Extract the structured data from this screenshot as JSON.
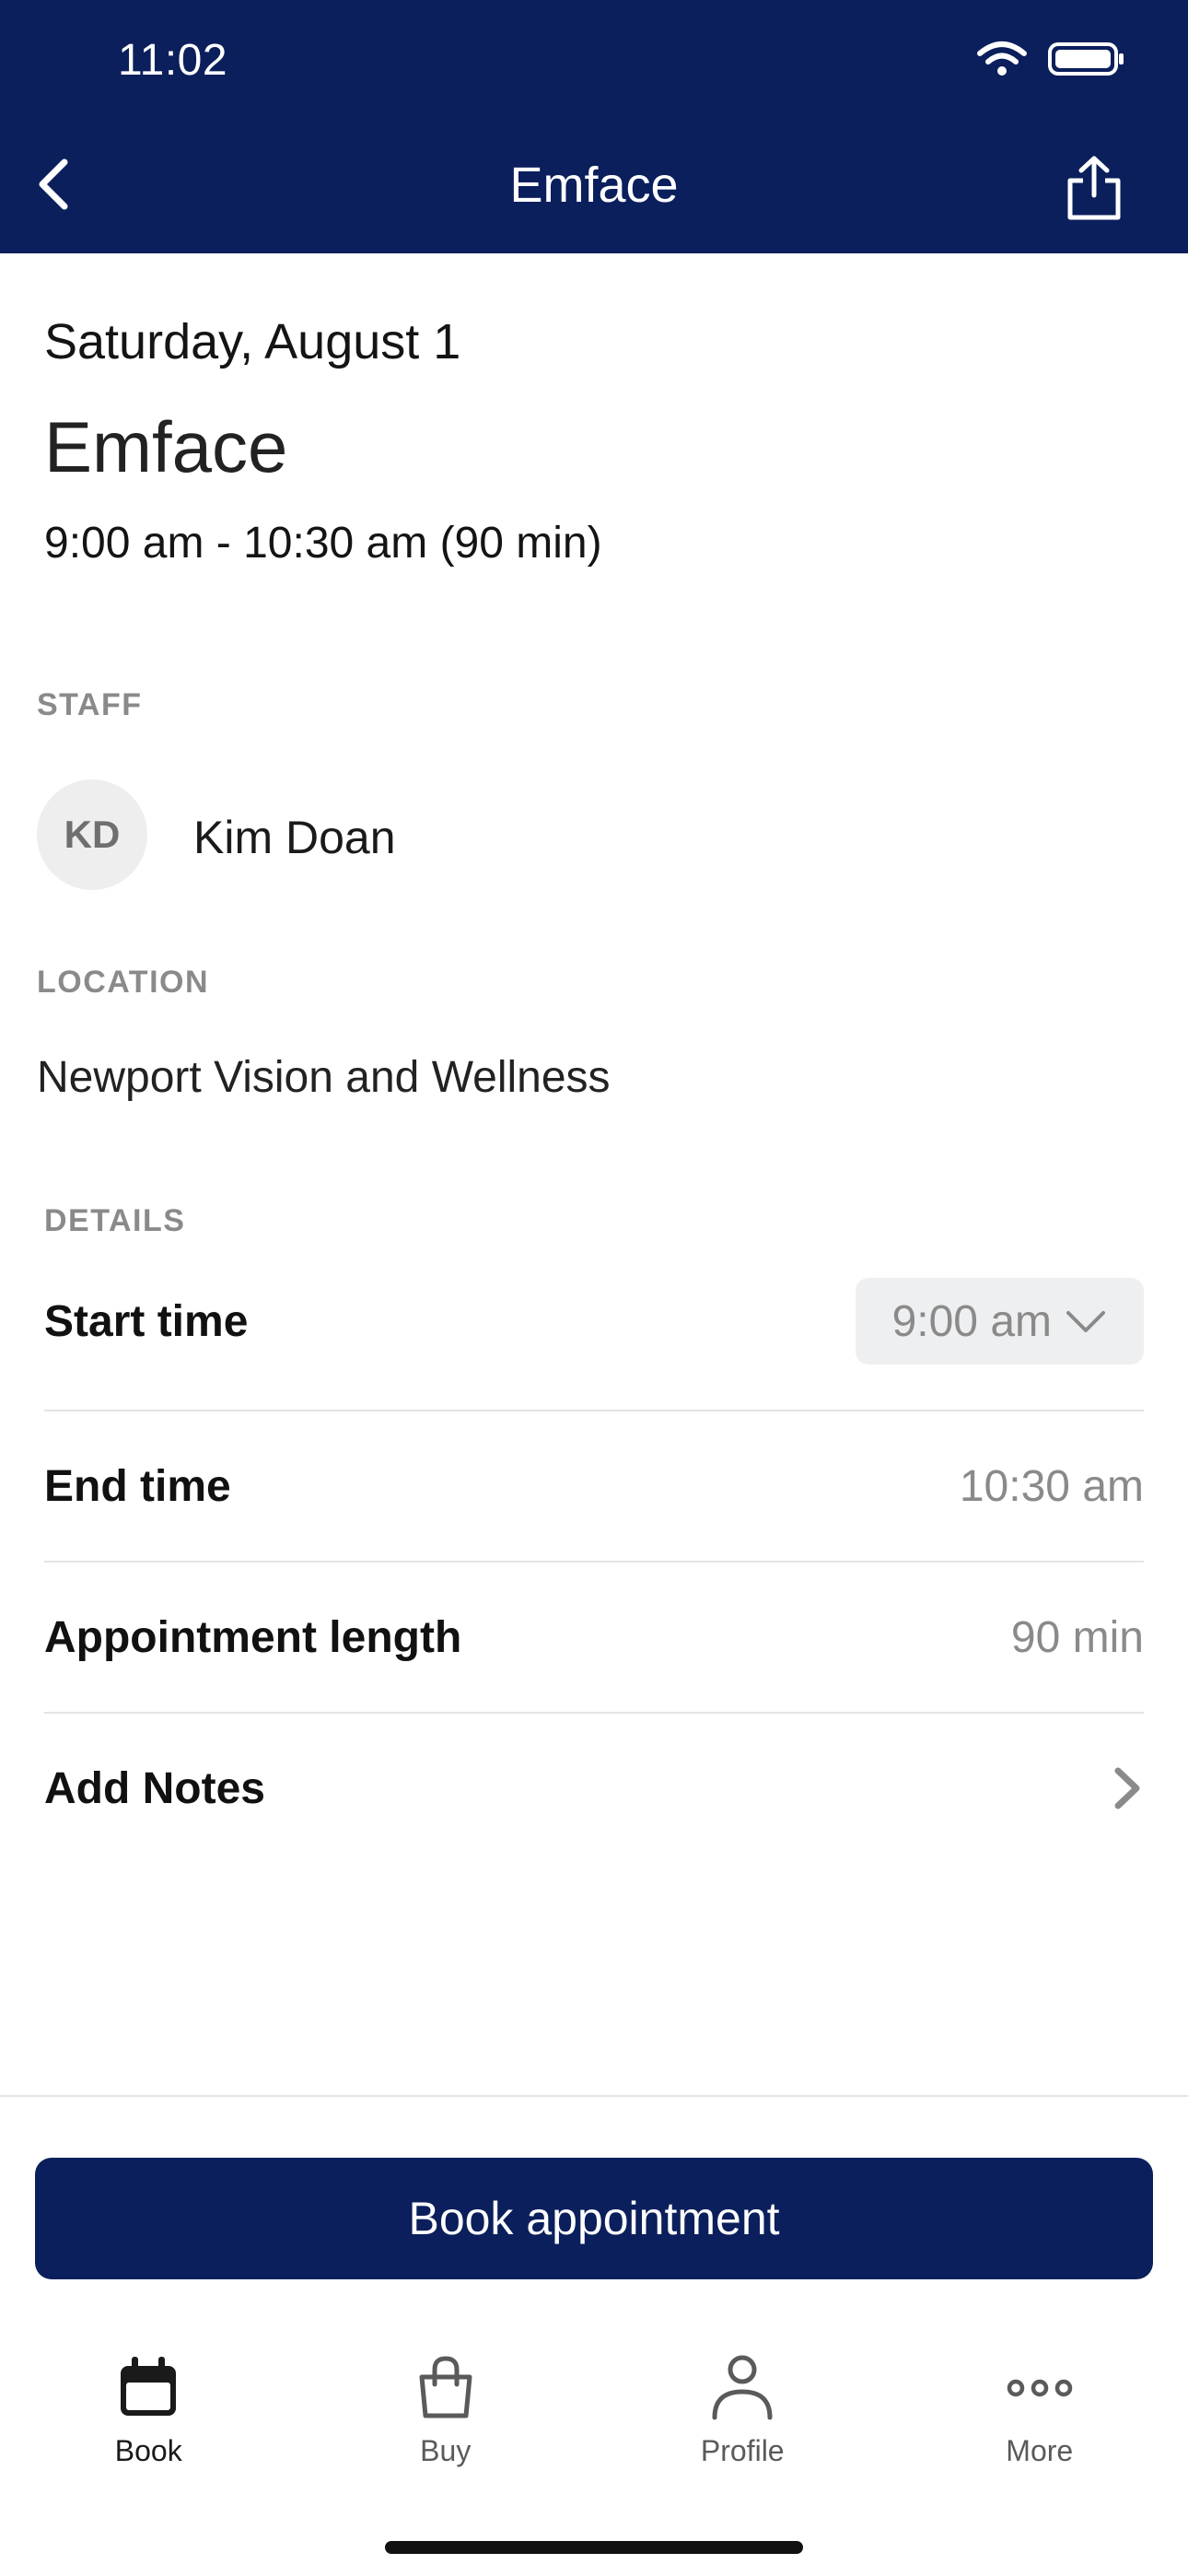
{
  "status_bar": {
    "time": "11:02"
  },
  "nav": {
    "title": "Emface"
  },
  "appointment": {
    "date": "Saturday, August 1",
    "service": "Emface",
    "time_range": "9:00 am - 10:30 am (90 min)"
  },
  "staff": {
    "section_label": "STAFF",
    "initials": "KD",
    "name": "Kim Doan"
  },
  "location": {
    "section_label": "LOCATION",
    "name": "Newport Vision and Wellness"
  },
  "details": {
    "section_label": "DETAILS",
    "start_time_label": "Start time",
    "start_time_value": "9:00 am",
    "end_time_label": "End time",
    "end_time_value": "10:30 am",
    "length_label": "Appointment length",
    "length_value": "90 min",
    "notes_label": "Add Notes"
  },
  "actions": {
    "book_label": "Book appointment"
  },
  "tabbar": {
    "items": [
      {
        "label": "Book",
        "icon": "calendar-icon",
        "active": true
      },
      {
        "label": "Buy",
        "icon": "shopping-bag-icon",
        "active": false
      },
      {
        "label": "Profile",
        "icon": "person-icon",
        "active": false
      },
      {
        "label": "More",
        "icon": "more-dots-icon",
        "active": false
      }
    ]
  },
  "colors": {
    "brand": "#0b1f5c",
    "muted": "#8a8a8a"
  }
}
